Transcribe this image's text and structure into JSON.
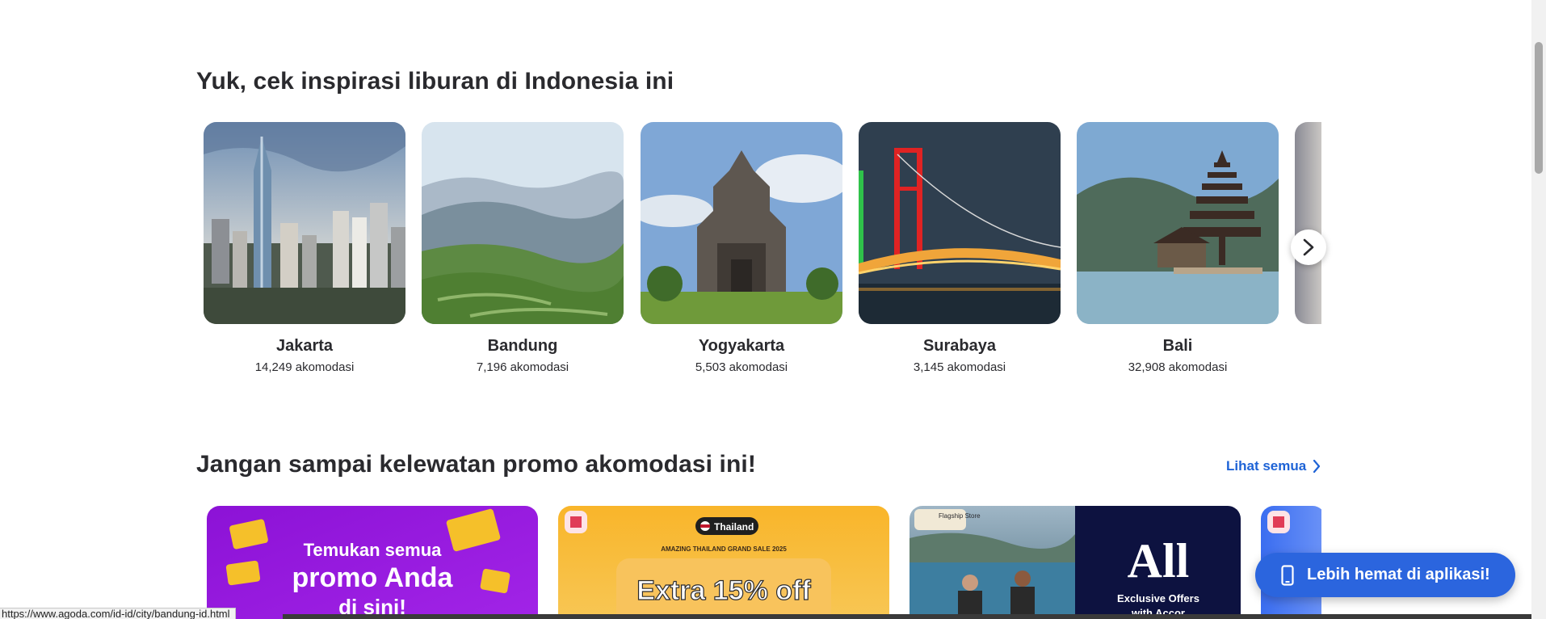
{
  "inspiration": {
    "title": "Yuk, cek inspirasi liburan di Indonesia ini",
    "destinations": [
      {
        "name": "Jakarta",
        "count": "14,249 akomodasi"
      },
      {
        "name": "Bandung",
        "count": "7,196 akomodasi"
      },
      {
        "name": "Yogyakarta",
        "count": "5,503 akomodasi"
      },
      {
        "name": "Surabaya",
        "count": "3,145 akomodasi"
      },
      {
        "name": "Bali",
        "count": "32,908 akomodasi"
      }
    ],
    "next_icon": "chevron-right-icon"
  },
  "promo": {
    "title": "Jangan sampai kelewatan promo akomodasi ini!",
    "see_all": "Lihat semua",
    "cards": [
      {
        "line1": "Temukan semua",
        "line2": "promo Anda",
        "line3": "di sini!"
      },
      {
        "badge": "Thailand",
        "subtitle": "AMAZING THAILAND GRAND SALE 2025",
        "offer": "Extra 15% off"
      },
      {
        "store_badge": "Flagship Store",
        "brand": "All",
        "line1": "Exclusive Offers",
        "line2": "with Accor"
      }
    ]
  },
  "app_banner": {
    "label": "Lebih hemat di aplikasi!",
    "icon": "smartphone-icon"
  },
  "status_bar": {
    "url": "https://www.agoda.com/id-id/city/bandung-id.html"
  },
  "colors": {
    "accent": "#1e63d6",
    "banner": "#2b65de",
    "text": "#2a2a2e"
  }
}
